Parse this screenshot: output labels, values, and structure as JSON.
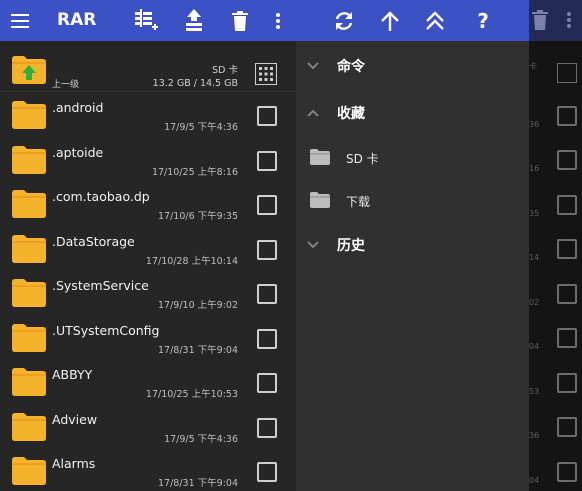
{
  "appbar": {
    "title": "RAR",
    "icons": [
      "menu-icon",
      "add-to-archive-icon",
      "extract-icon",
      "delete-icon",
      "more-vert-icon",
      "refresh-icon",
      "arrow-up-icon",
      "double-chevron-up-icon",
      "help-icon"
    ],
    "help_label": "?",
    "color": "#3b51c4"
  },
  "parent_row": {
    "label": "上一级",
    "storage": "SD 卡",
    "space": "13.2 GB / 14.5 GB"
  },
  "files": [
    {
      "name": ".android",
      "date": "17/9/5 下午4:36"
    },
    {
      "name": ".aptoide",
      "date": "17/10/25 上午8:16"
    },
    {
      "name": ".com.taobao.dp",
      "date": "17/10/6 下午9:35"
    },
    {
      "name": ".DataStorage",
      "date": "17/10/28 上午10:14"
    },
    {
      "name": ".SystemService",
      "date": "17/9/10 上午9:02"
    },
    {
      "name": ".UTSystemConfig",
      "date": "17/8/31 下午9:04"
    },
    {
      "name": "ABBYY",
      "date": "17/10/25 上午10:53"
    },
    {
      "name": "Adview",
      "date": "17/9/5 下午4:36"
    },
    {
      "name": "Alarms",
      "date": "17/8/31 下午9:04"
    }
  ],
  "drawer": {
    "commands": "命令",
    "favorites": "收藏",
    "fav_items": [
      "SD 卡",
      "下载"
    ],
    "history": "历史"
  },
  "background_fragments": [
    "卡",
    "36",
    "16",
    "35",
    "14",
    "02",
    "04",
    "53",
    "36",
    "04"
  ],
  "colors": {
    "folder": "#f5b22d",
    "folder_tab": "#e9a21f",
    "up_arrow": "#2eae3b",
    "drawer_bg": "#303030",
    "list_bg": "#262626"
  }
}
